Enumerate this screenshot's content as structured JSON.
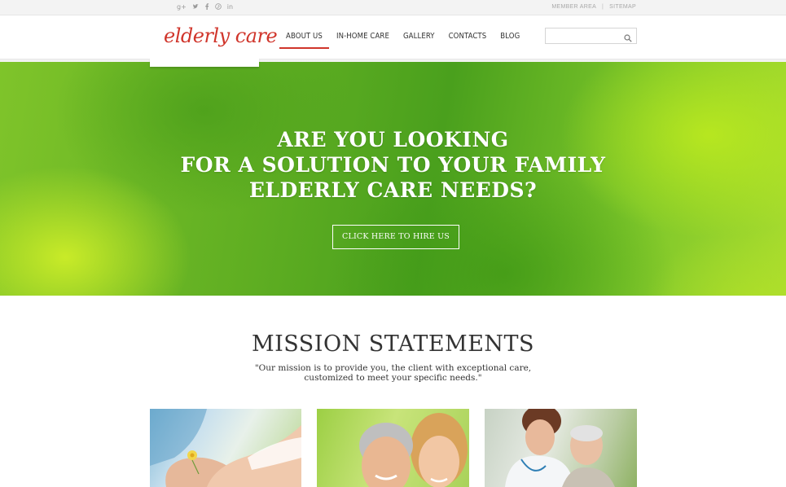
{
  "topbar": {
    "socials": [
      {
        "icon": "google-plus-icon",
        "glyph": "g+"
      },
      {
        "icon": "twitter-icon",
        "glyph": "t"
      },
      {
        "icon": "facebook-icon",
        "glyph": "f"
      },
      {
        "icon": "pinterest-icon",
        "glyph": "p"
      },
      {
        "icon": "linkedin-icon",
        "glyph": "in"
      }
    ],
    "member_area": "MEMBER AREA",
    "separator": "|",
    "sitemap": "SITEMAP"
  },
  "header": {
    "logo_text": "elderly care",
    "nav": [
      {
        "label": "ABOUT US",
        "active": true
      },
      {
        "label": "IN-HOME CARE",
        "active": false
      },
      {
        "label": "GALLERY",
        "active": false
      },
      {
        "label": "CONTACTS",
        "active": false
      },
      {
        "label": "BLOG",
        "active": false
      }
    ],
    "search_placeholder": ""
  },
  "hero": {
    "title_line1": "ARE YOU LOOKING",
    "title_line2": "FOR A SOLUTION TO YOUR FAMILY",
    "title_line3": "ELDERLY CARE NEEDS?",
    "button_label": "CLICK HERE TO HIRE US"
  },
  "mission": {
    "title": "MISSION STATEMENTS",
    "text_line1": "\"Our mission is to provide you, the client with exceptional care,",
    "text_line2": "customized to meet your specific needs.\""
  },
  "colors": {
    "accent": "#d0352b",
    "hero_green": "#5fae22"
  }
}
